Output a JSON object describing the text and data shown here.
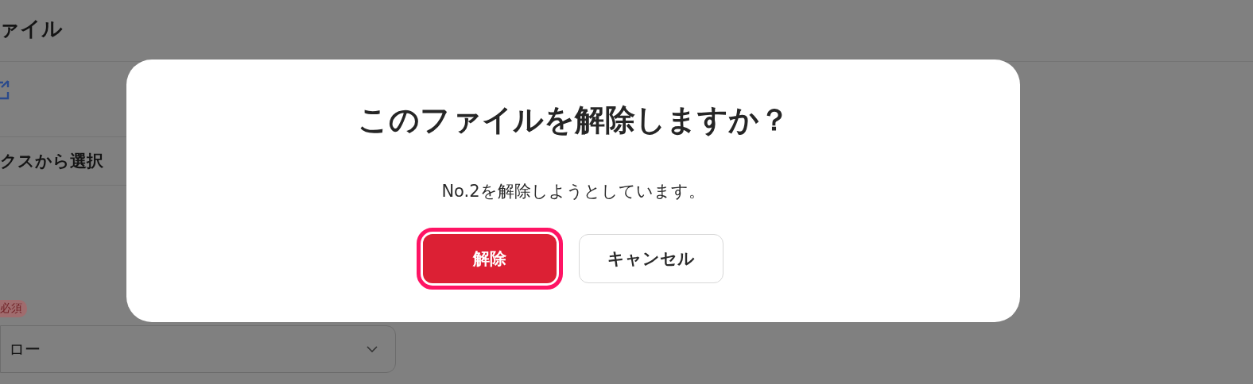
{
  "page": {
    "heading": "ァイル",
    "pick_button": "クスから選択",
    "required_badge": "必須",
    "select": {
      "value": "ロー"
    }
  },
  "dialog": {
    "title": "このファイルを解除しますか？",
    "message": "No.2を解除しようとしています。",
    "buttons": [
      {
        "label": "解除",
        "kind": "danger",
        "focused": true
      },
      {
        "label": "キャンセル",
        "kind": "secondary",
        "focused": false
      }
    ]
  }
}
